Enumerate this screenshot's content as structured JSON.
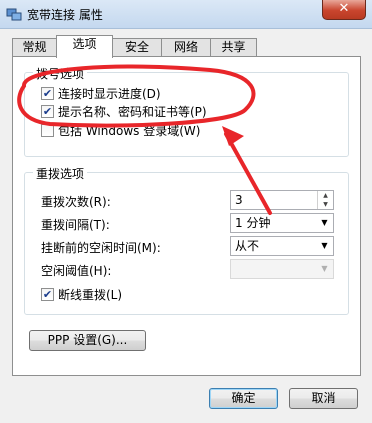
{
  "window": {
    "title": "宽带连接 属性",
    "close_glyph": "✕"
  },
  "tabs": [
    "常规",
    "选项",
    "安全",
    "网络",
    "共享"
  ],
  "active_tab": "选项",
  "dial_options": {
    "group_label": "拨号选项",
    "show_progress": {
      "label": "连接时显示进度(D)",
      "checked": true
    },
    "prompt_credentials": {
      "label": "提示名称、密码和证书等(P)",
      "checked": true
    },
    "include_domain": {
      "label": "包括 Windows 登录域(W)",
      "checked": false
    }
  },
  "redial_options": {
    "group_label": "重拨选项",
    "attempts": {
      "label": "重拨次数(R):",
      "value": "3"
    },
    "interval": {
      "label": "重拨间隔(T):",
      "value": "1 分钟"
    },
    "idle_hangup": {
      "label": "挂断前的空闲时间(M):",
      "value": "从不"
    },
    "idle_threshold": {
      "label": "空闲阈值(H):",
      "value": ""
    },
    "redial_on_drop": {
      "label": "断线重拨(L)",
      "checked": true
    }
  },
  "ppp_settings_label": "PPP 设置(G)...",
  "ok_label": "确定",
  "cancel_label": "取消",
  "check_glyph": "✔",
  "colors": {
    "annotation_red": "#e8262a",
    "title_bar": "#c4d8ef"
  }
}
